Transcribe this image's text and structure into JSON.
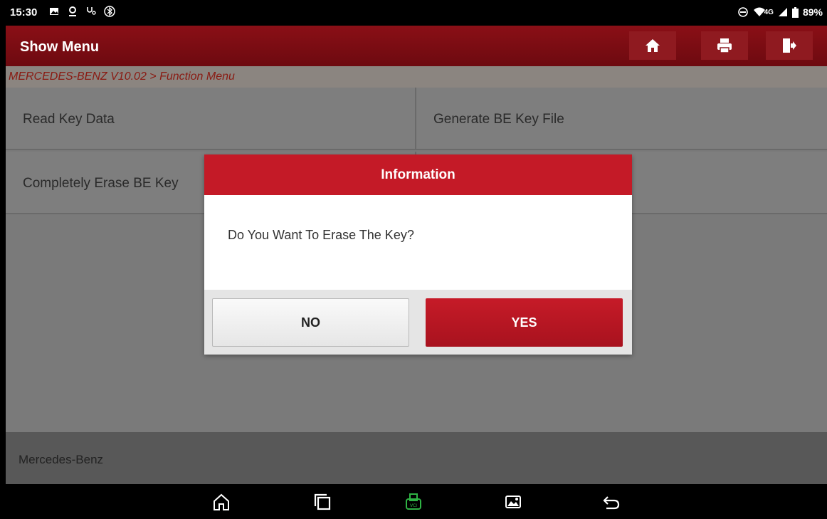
{
  "status_bar": {
    "time": "15:30",
    "icons": [
      "image-icon",
      "location-icon",
      "stethoscope-icon",
      "bluetooth-icon"
    ],
    "network": "4G",
    "battery": "89%"
  },
  "header": {
    "title": "Show Menu",
    "buttons": [
      "home-icon",
      "print-icon",
      "exit-icon"
    ]
  },
  "breadcrumb": "MERCEDES-BENZ V10.02 > Function Menu",
  "menu": {
    "items": [
      "Read Key Data",
      "Generate BE Key File",
      "Completely Erase BE Key"
    ]
  },
  "vehicle": "Mercedes-Benz",
  "dialog": {
    "title": "Information",
    "message": "Do You Want To Erase The Key?",
    "no_label": "NO",
    "yes_label": "YES"
  },
  "colors": {
    "header": "#7a0d13",
    "accent": "#c41a27",
    "vci_green": "#2fb344"
  }
}
